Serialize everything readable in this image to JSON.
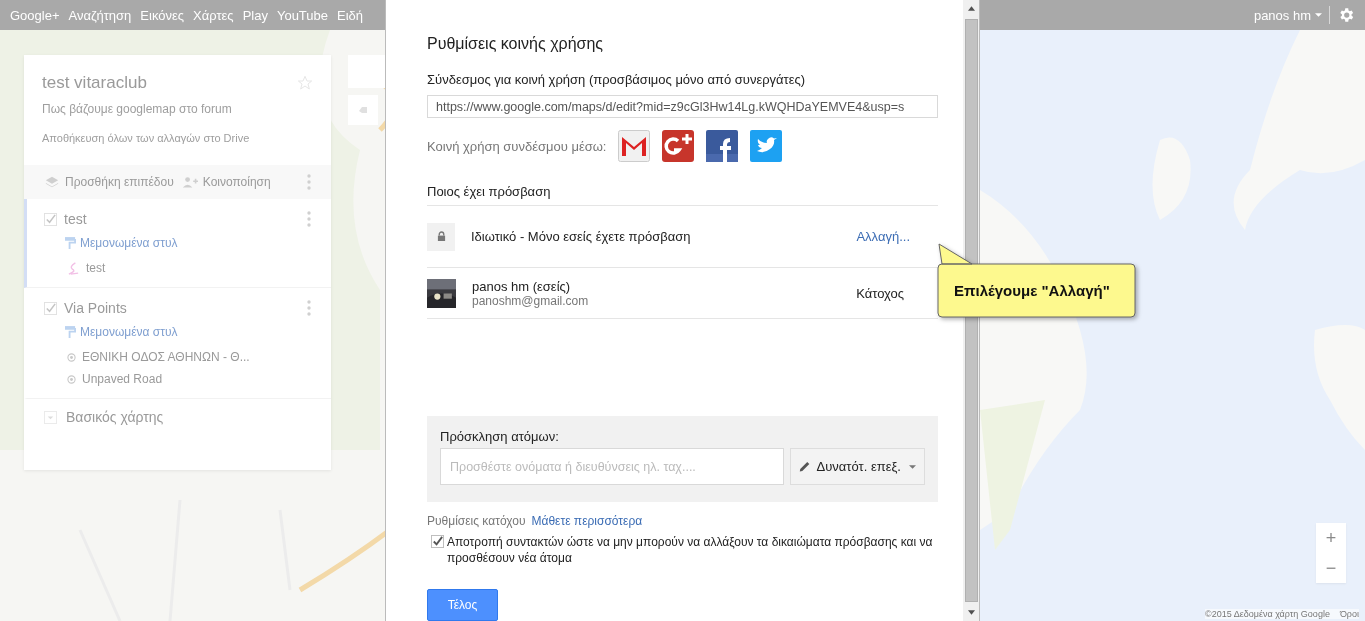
{
  "top_bar": {
    "links": [
      "Google+",
      "Αναζήτηση",
      "Εικόνες",
      "Χάρτες",
      "Play",
      "YouTube",
      "Ειδή"
    ],
    "user": "panos hm"
  },
  "map_panel": {
    "title": "test vitaraclub",
    "description": "Πως βάζουμε googlemap στο forum",
    "save_status": "Αποθήκευση όλων των αλλαγών στο Drive",
    "toolbar": [
      {
        "kind": "layer",
        "label": "Προσθήκη επιπέδου"
      },
      {
        "kind": "share",
        "label": "Κοινοποίηση"
      }
    ],
    "layers": [
      {
        "name": "test",
        "checked": true,
        "selected": true,
        "style": "Μεμονωμένα στυλ",
        "items": [
          {
            "kind": "line",
            "label": "test"
          }
        ]
      },
      {
        "name": "Via Points",
        "checked": true,
        "selected": false,
        "style": "Μεμονωμένα στυλ",
        "items": [
          {
            "kind": "point",
            "label": "ΕΘΝΙΚΗ ΟΔΟΣ ΑΘΗΝΩΝ - Θ..."
          },
          {
            "kind": "point",
            "label": "Unpaved Road"
          }
        ]
      }
    ],
    "base_map": "Βασικός χάρτης"
  },
  "map": {
    "kind": "picture",
    "zoom_in": "+",
    "zoom_out": "−",
    "attribution": "©2015 Δεδομένα χάρτη Google",
    "terms": "Όροι"
  },
  "dialog": {
    "title": "Ρυθμίσεις κοινής χρήσης",
    "link_label": "Σύνδεσμος για κοινή χρήση (προσβάσιμος μόνο από συνεργάτες)",
    "link_url": "https://www.google.com/maps/d/edit?mid=z9cGl3Hw14Lg.kWQHDaYEMVE4&usp=s",
    "share_label": "Κοινή χρήση συνδέσμου μέσω:",
    "share_services": [
      {
        "kind": "gmail"
      },
      {
        "kind": "gplus"
      },
      {
        "kind": "facebook"
      },
      {
        "kind": "twitter"
      }
    ],
    "access_heading": "Ποιος έχει πρόσβαση",
    "access": [
      {
        "kind": "visibility",
        "text": "Ιδιωτικό - Μόνο εσείς έχετε πρόσβαση",
        "action": "Αλλαγή..."
      },
      {
        "kind": "person",
        "name": "panos hm (εσείς)",
        "email": "panoshm@gmail.com",
        "role": "Κάτοχος"
      }
    ],
    "invite": {
      "label": "Πρόσκληση ατόμων:",
      "placeholder": "Προσθέστε ονόματα ή διευθύνσεις ηλ. ταχ....",
      "permission": "Δυνατότ. επεξ."
    },
    "owner_settings": {
      "label": "Ρυθμίσεις κατόχου",
      "link": "Μάθετε περισσότερα",
      "checked": true,
      "checkbox_label": "Αποτροπή συντακτών ώστε να μην μπορούν να αλλάξουν τα δικαιώματα πρόσβασης και να προσθέσουν νέα άτομα"
    },
    "done_button": "Τέλος"
  },
  "callout": {
    "text": "Επιλέγουμε \"Αλλαγή\""
  }
}
